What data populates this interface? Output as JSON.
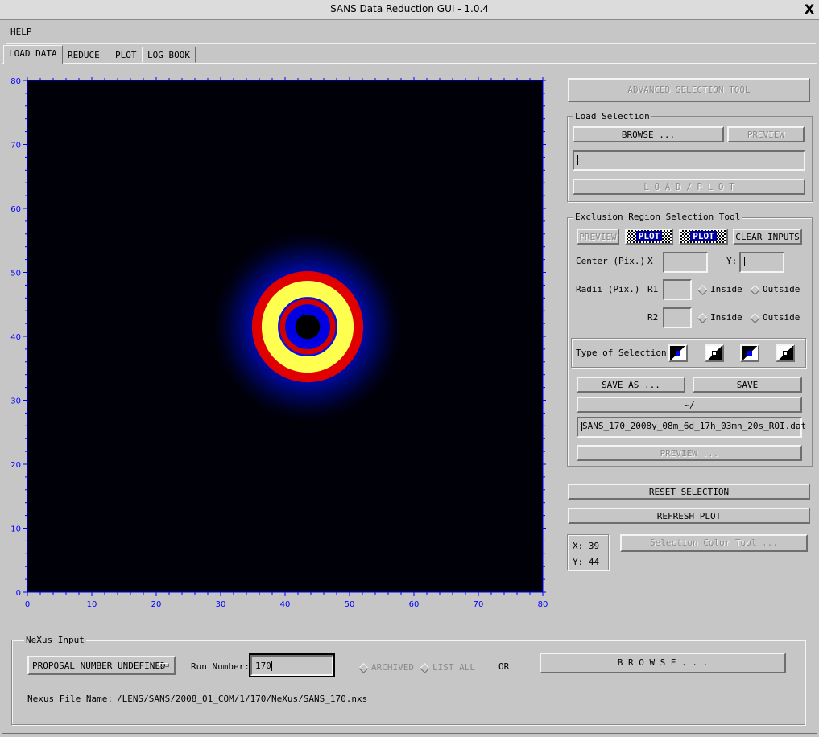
{
  "window": {
    "title": "SANS Data Reduction GUI - 1.0.4",
    "close_glyph": "X"
  },
  "menu": {
    "help": "HELP"
  },
  "tabs": [
    {
      "label": "LOAD DATA",
      "active": true
    },
    {
      "label": "REDUCE",
      "active": false
    },
    {
      "label": "PLOT",
      "active": false
    },
    {
      "label": "LOG BOOK",
      "active": false
    }
  ],
  "plot": {
    "x_ticks": [
      "0",
      "10",
      "20",
      "30",
      "40",
      "50",
      "60",
      "70",
      "80"
    ],
    "y_ticks": [
      "0",
      "10",
      "20",
      "30",
      "40",
      "50",
      "60",
      "70",
      "80"
    ],
    "xlim": [
      0,
      80
    ],
    "ylim": [
      0,
      80
    ],
    "ring_center": [
      43.5,
      41.5
    ],
    "ring_radius": 6,
    "colors": {
      "background": "#000000",
      "axis": "#0000ff",
      "halo": "#0010ff",
      "ring_outer": "#ff0000",
      "ring_inner": "#ffff40",
      "core": "#0000ff"
    }
  },
  "right_panel": {
    "advanced_selection_tool": "ADVANCED SELECTION TOOL",
    "load_selection": {
      "title": "Load Selection",
      "browse": "BROWSE ...",
      "preview": "PREVIEW",
      "load_plot": "L O A D / P L O T"
    },
    "exclusion": {
      "title": "Exclusion Region Selection Tool",
      "preview": "PREVIEW",
      "plot1": "PLOT",
      "plot2": "PLOT",
      "clear_inputs": "CLEAR INPUTS",
      "center_label": "Center (Pix.)",
      "x_label": "X",
      "y_label": "Y:",
      "radii_label": "Radii (Pix.)",
      "r1_label": "R1",
      "r2_label": "R2",
      "inside": "Inside",
      "outside": "Outside",
      "type_label": "Type of Selection:",
      "save_as": "SAVE AS ...",
      "save": "SAVE",
      "path": "~/",
      "filename": "SANS_170_2008y_08m_6d_17h_03mn_20s_ROI.dat",
      "preview2": "PREVIEW ..."
    },
    "reset_selection": "RESET SELECTION",
    "refresh_plot": "REFRESH PLOT",
    "cursor_x": "X: 39",
    "cursor_y": "Y: 44",
    "selection_color_tool": "Selection Color Tool ..."
  },
  "nexus": {
    "title": "NeXus Input",
    "proposal": "PROPOSAL NUMBER UNDEFINED",
    "run_number_label": "Run Number:",
    "run_number": "170",
    "archived": "ARCHIVED",
    "list_all": "LIST ALL",
    "or": "OR",
    "browse": "B R O W S E . . .",
    "file_name_label": "Nexus File Name:",
    "file_name": "/LENS/SANS/2008_01_COM/1/170/NeXus/SANS_170.nxs"
  }
}
